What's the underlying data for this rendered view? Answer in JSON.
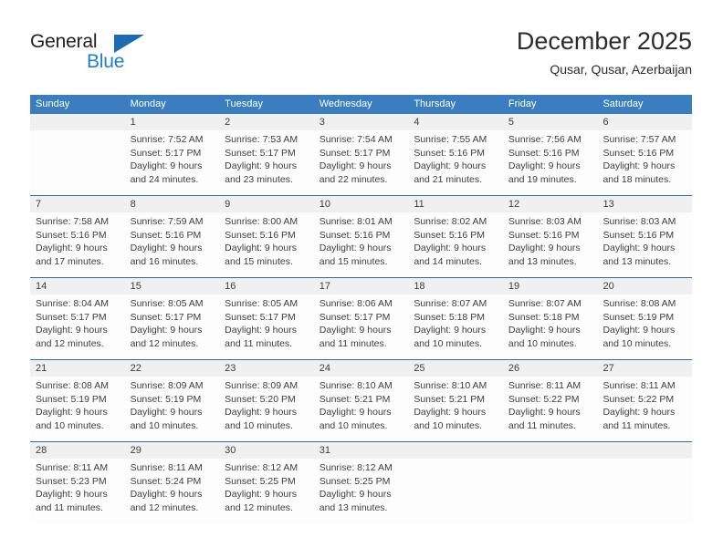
{
  "brand": {
    "name_part1": "General",
    "name_part2": "Blue",
    "triangle_icon": "triangle-icon",
    "colors": {
      "dark": "#231f20",
      "blue": "#1b7fd4",
      "triangle": "#1b6cb5"
    }
  },
  "header": {
    "title": "December 2025",
    "subtitle": "Qusar, Qusar, Azerbaijan"
  },
  "theme": {
    "header_bar": "#3a7ebf",
    "week_divider": "#2e6da4",
    "daynum_band": "#f0f0f0",
    "text": "#3d3d3d"
  },
  "weekdays": [
    "Sunday",
    "Monday",
    "Tuesday",
    "Wednesday",
    "Thursday",
    "Friday",
    "Saturday"
  ],
  "weeks": [
    {
      "days": [
        {
          "num": "",
          "lines": []
        },
        {
          "num": "1",
          "lines": [
            "Sunrise: 7:52 AM",
            "Sunset: 5:17 PM",
            "Daylight: 9 hours",
            "and 24 minutes."
          ]
        },
        {
          "num": "2",
          "lines": [
            "Sunrise: 7:53 AM",
            "Sunset: 5:17 PM",
            "Daylight: 9 hours",
            "and 23 minutes."
          ]
        },
        {
          "num": "3",
          "lines": [
            "Sunrise: 7:54 AM",
            "Sunset: 5:17 PM",
            "Daylight: 9 hours",
            "and 22 minutes."
          ]
        },
        {
          "num": "4",
          "lines": [
            "Sunrise: 7:55 AM",
            "Sunset: 5:16 PM",
            "Daylight: 9 hours",
            "and 21 minutes."
          ]
        },
        {
          "num": "5",
          "lines": [
            "Sunrise: 7:56 AM",
            "Sunset: 5:16 PM",
            "Daylight: 9 hours",
            "and 19 minutes."
          ]
        },
        {
          "num": "6",
          "lines": [
            "Sunrise: 7:57 AM",
            "Sunset: 5:16 PM",
            "Daylight: 9 hours",
            "and 18 minutes."
          ]
        }
      ]
    },
    {
      "days": [
        {
          "num": "7",
          "lines": [
            "Sunrise: 7:58 AM",
            "Sunset: 5:16 PM",
            "Daylight: 9 hours",
            "and 17 minutes."
          ]
        },
        {
          "num": "8",
          "lines": [
            "Sunrise: 7:59 AM",
            "Sunset: 5:16 PM",
            "Daylight: 9 hours",
            "and 16 minutes."
          ]
        },
        {
          "num": "9",
          "lines": [
            "Sunrise: 8:00 AM",
            "Sunset: 5:16 PM",
            "Daylight: 9 hours",
            "and 15 minutes."
          ]
        },
        {
          "num": "10",
          "lines": [
            "Sunrise: 8:01 AM",
            "Sunset: 5:16 PM",
            "Daylight: 9 hours",
            "and 15 minutes."
          ]
        },
        {
          "num": "11",
          "lines": [
            "Sunrise: 8:02 AM",
            "Sunset: 5:16 PM",
            "Daylight: 9 hours",
            "and 14 minutes."
          ]
        },
        {
          "num": "12",
          "lines": [
            "Sunrise: 8:03 AM",
            "Sunset: 5:16 PM",
            "Daylight: 9 hours",
            "and 13 minutes."
          ]
        },
        {
          "num": "13",
          "lines": [
            "Sunrise: 8:03 AM",
            "Sunset: 5:16 PM",
            "Daylight: 9 hours",
            "and 13 minutes."
          ]
        }
      ]
    },
    {
      "days": [
        {
          "num": "14",
          "lines": [
            "Sunrise: 8:04 AM",
            "Sunset: 5:17 PM",
            "Daylight: 9 hours",
            "and 12 minutes."
          ]
        },
        {
          "num": "15",
          "lines": [
            "Sunrise: 8:05 AM",
            "Sunset: 5:17 PM",
            "Daylight: 9 hours",
            "and 12 minutes."
          ]
        },
        {
          "num": "16",
          "lines": [
            "Sunrise: 8:05 AM",
            "Sunset: 5:17 PM",
            "Daylight: 9 hours",
            "and 11 minutes."
          ]
        },
        {
          "num": "17",
          "lines": [
            "Sunrise: 8:06 AM",
            "Sunset: 5:17 PM",
            "Daylight: 9 hours",
            "and 11 minutes."
          ]
        },
        {
          "num": "18",
          "lines": [
            "Sunrise: 8:07 AM",
            "Sunset: 5:18 PM",
            "Daylight: 9 hours",
            "and 10 minutes."
          ]
        },
        {
          "num": "19",
          "lines": [
            "Sunrise: 8:07 AM",
            "Sunset: 5:18 PM",
            "Daylight: 9 hours",
            "and 10 minutes."
          ]
        },
        {
          "num": "20",
          "lines": [
            "Sunrise: 8:08 AM",
            "Sunset: 5:19 PM",
            "Daylight: 9 hours",
            "and 10 minutes."
          ]
        }
      ]
    },
    {
      "days": [
        {
          "num": "21",
          "lines": [
            "Sunrise: 8:08 AM",
            "Sunset: 5:19 PM",
            "Daylight: 9 hours",
            "and 10 minutes."
          ]
        },
        {
          "num": "22",
          "lines": [
            "Sunrise: 8:09 AM",
            "Sunset: 5:19 PM",
            "Daylight: 9 hours",
            "and 10 minutes."
          ]
        },
        {
          "num": "23",
          "lines": [
            "Sunrise: 8:09 AM",
            "Sunset: 5:20 PM",
            "Daylight: 9 hours",
            "and 10 minutes."
          ]
        },
        {
          "num": "24",
          "lines": [
            "Sunrise: 8:10 AM",
            "Sunset: 5:21 PM",
            "Daylight: 9 hours",
            "and 10 minutes."
          ]
        },
        {
          "num": "25",
          "lines": [
            "Sunrise: 8:10 AM",
            "Sunset: 5:21 PM",
            "Daylight: 9 hours",
            "and 10 minutes."
          ]
        },
        {
          "num": "26",
          "lines": [
            "Sunrise: 8:11 AM",
            "Sunset: 5:22 PM",
            "Daylight: 9 hours",
            "and 11 minutes."
          ]
        },
        {
          "num": "27",
          "lines": [
            "Sunrise: 8:11 AM",
            "Sunset: 5:22 PM",
            "Daylight: 9 hours",
            "and 11 minutes."
          ]
        }
      ]
    },
    {
      "days": [
        {
          "num": "28",
          "lines": [
            "Sunrise: 8:11 AM",
            "Sunset: 5:23 PM",
            "Daylight: 9 hours",
            "and 11 minutes."
          ]
        },
        {
          "num": "29",
          "lines": [
            "Sunrise: 8:11 AM",
            "Sunset: 5:24 PM",
            "Daylight: 9 hours",
            "and 12 minutes."
          ]
        },
        {
          "num": "30",
          "lines": [
            "Sunrise: 8:12 AM",
            "Sunset: 5:25 PM",
            "Daylight: 9 hours",
            "and 12 minutes."
          ]
        },
        {
          "num": "31",
          "lines": [
            "Sunrise: 8:12 AM",
            "Sunset: 5:25 PM",
            "Daylight: 9 hours",
            "and 13 minutes."
          ]
        },
        {
          "num": "",
          "lines": []
        },
        {
          "num": "",
          "lines": []
        },
        {
          "num": "",
          "lines": []
        }
      ]
    }
  ]
}
